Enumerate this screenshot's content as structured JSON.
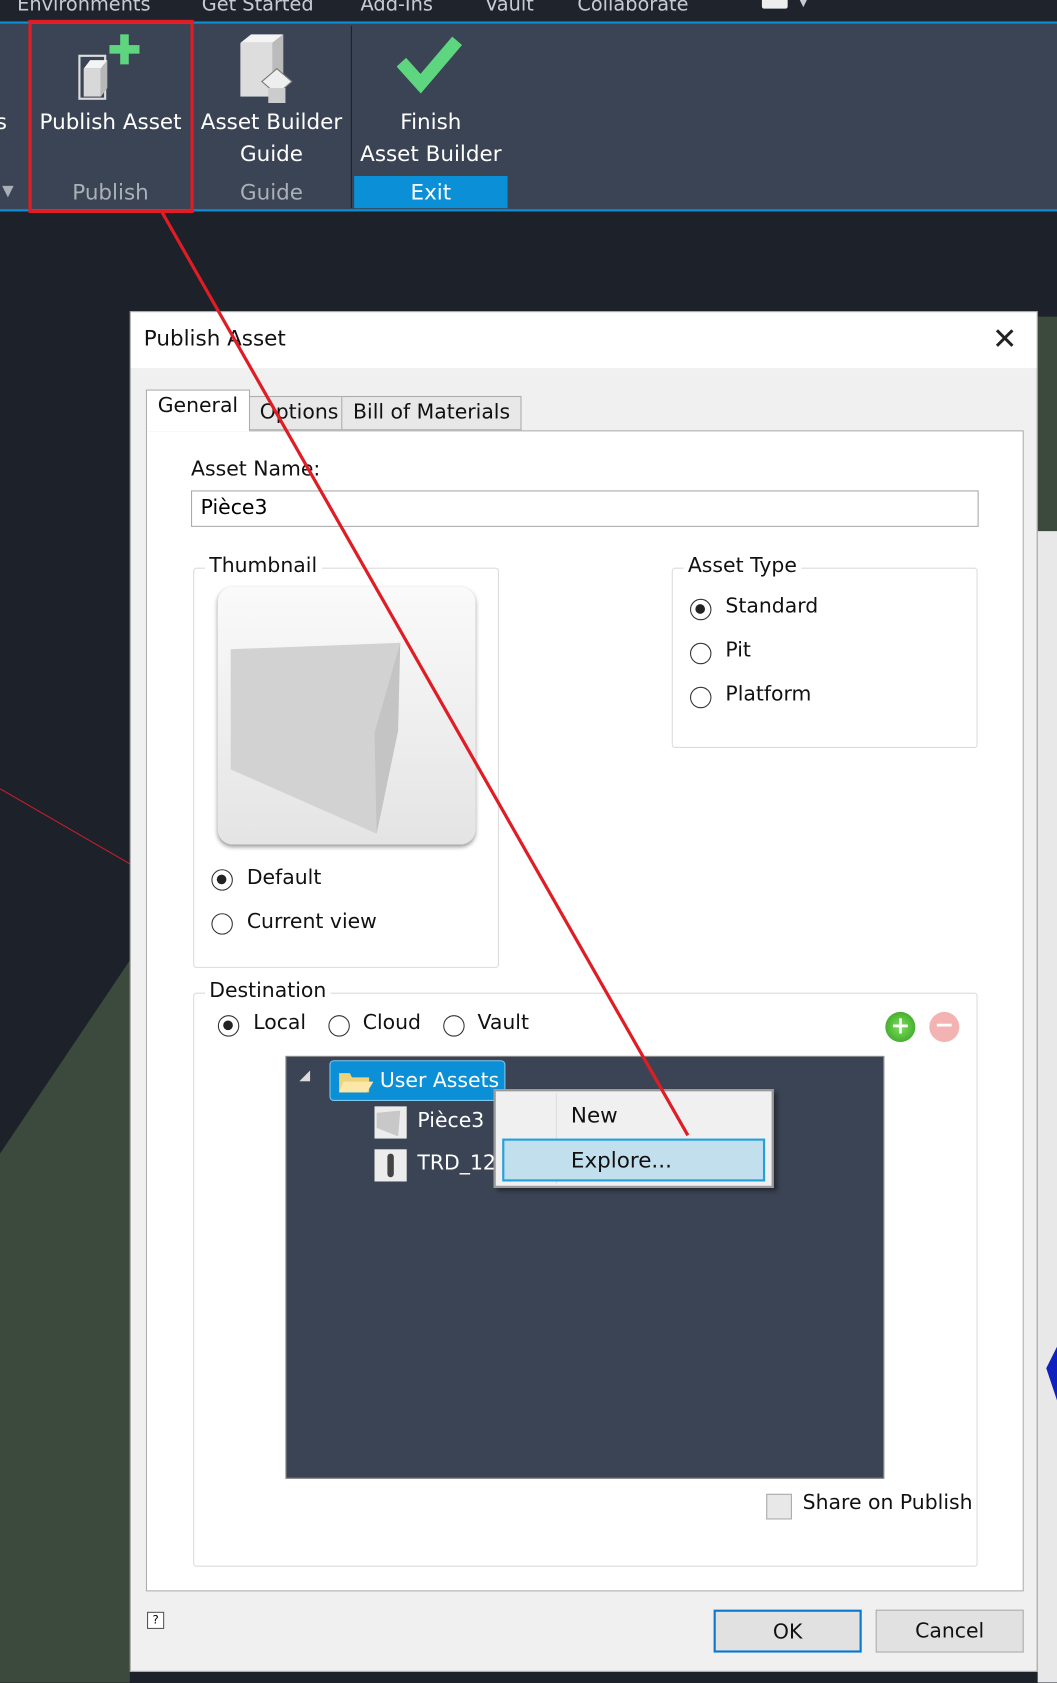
{
  "ribbon": {
    "tabs": [
      "Environments",
      "Get Started",
      "Add-Ins",
      "Vault",
      "Collaborate"
    ],
    "buttons": {
      "publish_asset": "Publish Asset",
      "guide_line1": "Asset Builder",
      "guide_line2": "Guide",
      "finish_line1": "Finish",
      "finish_line2": "Asset Builder"
    },
    "groups": {
      "publish": "Publish",
      "guide": "Guide",
      "exit": "Exit"
    },
    "left_cut": "s"
  },
  "dialog": {
    "title": "Publish Asset",
    "tabs": [
      "General",
      "Options",
      "Bill of Materials"
    ],
    "asset_name_label": "Asset Name:",
    "asset_name_value": "Pièce3",
    "thumbnail": {
      "legend": "Thumbnail",
      "options": [
        "Default",
        "Current view"
      ],
      "selected": "Default"
    },
    "asset_type": {
      "legend": "Asset Type",
      "options": [
        "Standard",
        "Pit",
        "Platform"
      ],
      "selected": "Standard"
    },
    "destination": {
      "legend": "Destination",
      "options": [
        "Local",
        "Cloud",
        "Vault"
      ],
      "selected": "Local"
    },
    "tree": {
      "root": "User Assets",
      "children": [
        "Pièce3",
        "TRD_12"
      ]
    },
    "context_menu": [
      "New",
      "Explore..."
    ],
    "share_label": "Share on Publish",
    "ok": "OK",
    "cancel": "Cancel"
  },
  "colors": {
    "accent": "#0b8fd6",
    "annotation": "#e01c24",
    "ribbon_bg": "#3b4454"
  }
}
